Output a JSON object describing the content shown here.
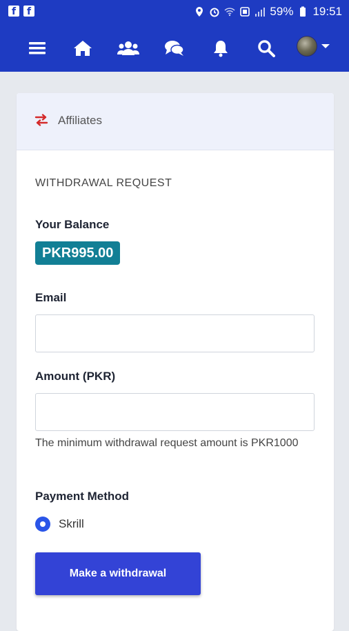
{
  "status_bar": {
    "battery": "59%",
    "time": "19:51",
    "left_icons": [
      "facebook-icon",
      "facebook-icon"
    ]
  },
  "nav": {
    "items": [
      "menu-icon",
      "home-icon",
      "users-icon",
      "chat-icon",
      "bell-icon",
      "search-icon"
    ]
  },
  "card": {
    "header_title": "Affiliates",
    "section_title": "WITHDRAWAL REQUEST",
    "balance_label": "Your Balance",
    "balance_value": "PKR995.00",
    "email_label": "Email",
    "email_value": "",
    "amount_label": "Amount (PKR)",
    "amount_value": "",
    "help_text": "The minimum withdrawal request amount is PKR1000",
    "payment_label": "Payment Method",
    "payment_option": "Skrill",
    "submit_label": "Make a withdrawal"
  },
  "colors": {
    "topbar": "#1e3bc2",
    "badge": "#127f95",
    "button": "#3343d6",
    "header_icon": "#d42a2a"
  }
}
